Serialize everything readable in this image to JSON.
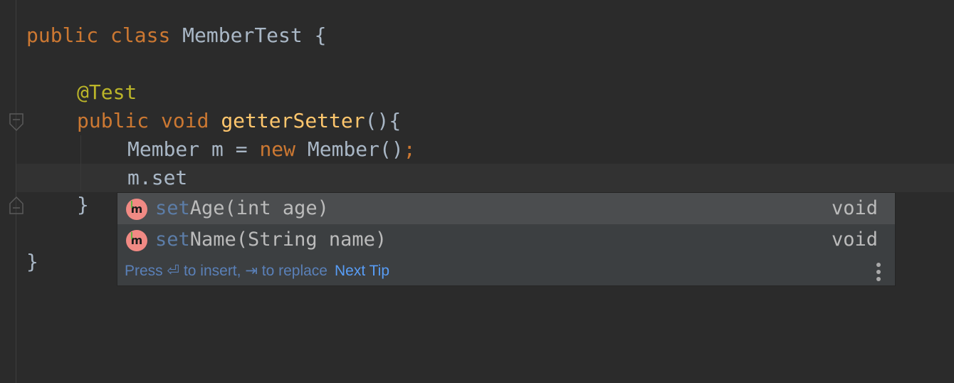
{
  "code": {
    "line1": {
      "kw1": "public",
      "kw2": "class",
      "name": "MemberTest",
      "brace": "{"
    },
    "line3": {
      "annotation": "@Test"
    },
    "line4": {
      "kw1": "public",
      "kw2": "void",
      "method": "getterSetter",
      "rest": "(){"
    },
    "line5": {
      "decl": "Member m = ",
      "kw": "new",
      "ctor": "Member()",
      "semi": ";"
    },
    "line6": {
      "text": "m.set"
    },
    "line7": {
      "text": "}"
    },
    "line9": {
      "text": "}"
    }
  },
  "completion": {
    "items": [
      {
        "icon": "method-icon",
        "icon_letter": "m",
        "match": "set",
        "rest": "Age(int age)",
        "type": "void",
        "selected": true
      },
      {
        "icon": "method-icon",
        "icon_letter": "m",
        "match": "set",
        "rest": "Name(String name)",
        "type": "void",
        "selected": false
      }
    ],
    "hint": "Press ⏎ to insert, ⇥ to replace",
    "next_tip": "Next Tip",
    "menu_icon": "kebab-menu-icon"
  },
  "colors": {
    "background": "#2b2b2b",
    "keyword": "#cc7832",
    "method_name": "#ffc66d",
    "annotation": "#bbb529",
    "text": "#a9b7c6",
    "popup_bg": "#3c3f41",
    "selection": "#4b4d4f",
    "match_text": "#5c7da8",
    "link": "#589df6",
    "method_icon": "#f18a84"
  }
}
